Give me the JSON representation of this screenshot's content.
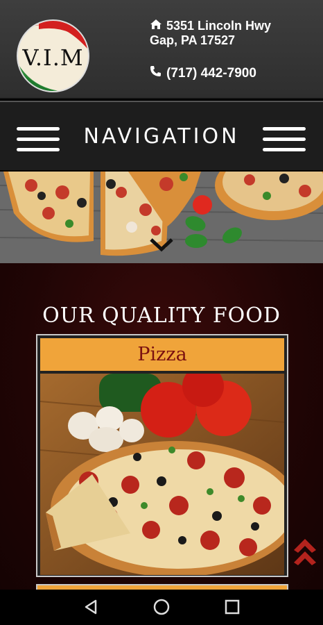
{
  "header": {
    "logo_text": "V.I.M",
    "address_line1": "5351 Lincoln Hwy",
    "address_line2": "Gap, PA 17527",
    "phone": "(717) 442-7900",
    "icons": {
      "address": "home-icon",
      "phone": "phone-icon"
    }
  },
  "nav": {
    "title": "NAVIGATION",
    "icons": {
      "left": "menu-icon",
      "right": "menu-icon"
    }
  },
  "hero": {
    "scroll_hint_icon": "chevron-down-icon"
  },
  "content": {
    "section_title": "OUR QUALITY FOOD",
    "cards": [
      {
        "title": "Pizza"
      }
    ]
  },
  "system_nav": {
    "buttons": [
      "back-icon",
      "home-circle-icon",
      "recents-icon"
    ]
  },
  "colors": {
    "header_bg": "#3a3a3a",
    "nav_bg": "#1d1d1d",
    "content_bg": "#2a0707",
    "card_header": "#f0a43a",
    "card_title": "#7a1010",
    "accent_red": "#b3231d"
  }
}
